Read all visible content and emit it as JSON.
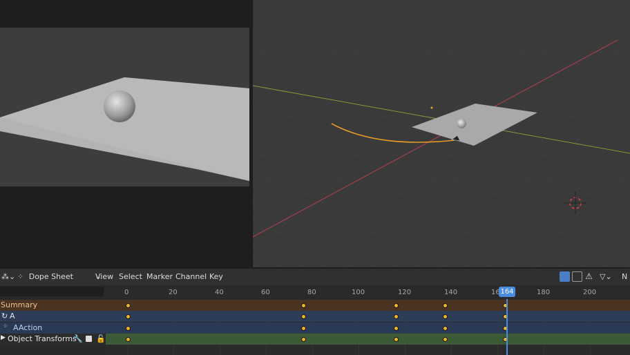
{
  "editor": {
    "mode_label": "Dope Sheet",
    "menus": [
      "View",
      "Select",
      "Marker",
      "Channel",
      "Key"
    ],
    "right_label": "N"
  },
  "channels": {
    "search_value": "",
    "summary": "Summary",
    "object": "A",
    "action": "AAction",
    "group": "Object Transforms"
  },
  "timeline": {
    "ticks": [
      "0",
      "20",
      "40",
      "60",
      "80",
      "100",
      "120",
      "140",
      "16",
      "180",
      "200"
    ],
    "current_frame": "164",
    "keyframes": [
      1,
      77,
      117,
      138,
      164
    ]
  },
  "colors": {
    "summary_row": "#4a3320",
    "object_row": "#2d3c57",
    "action_row": "#2a3a55",
    "group_row": "#3c5a35",
    "keyframe": "#f0b429",
    "playhead": "#4a8de0"
  }
}
